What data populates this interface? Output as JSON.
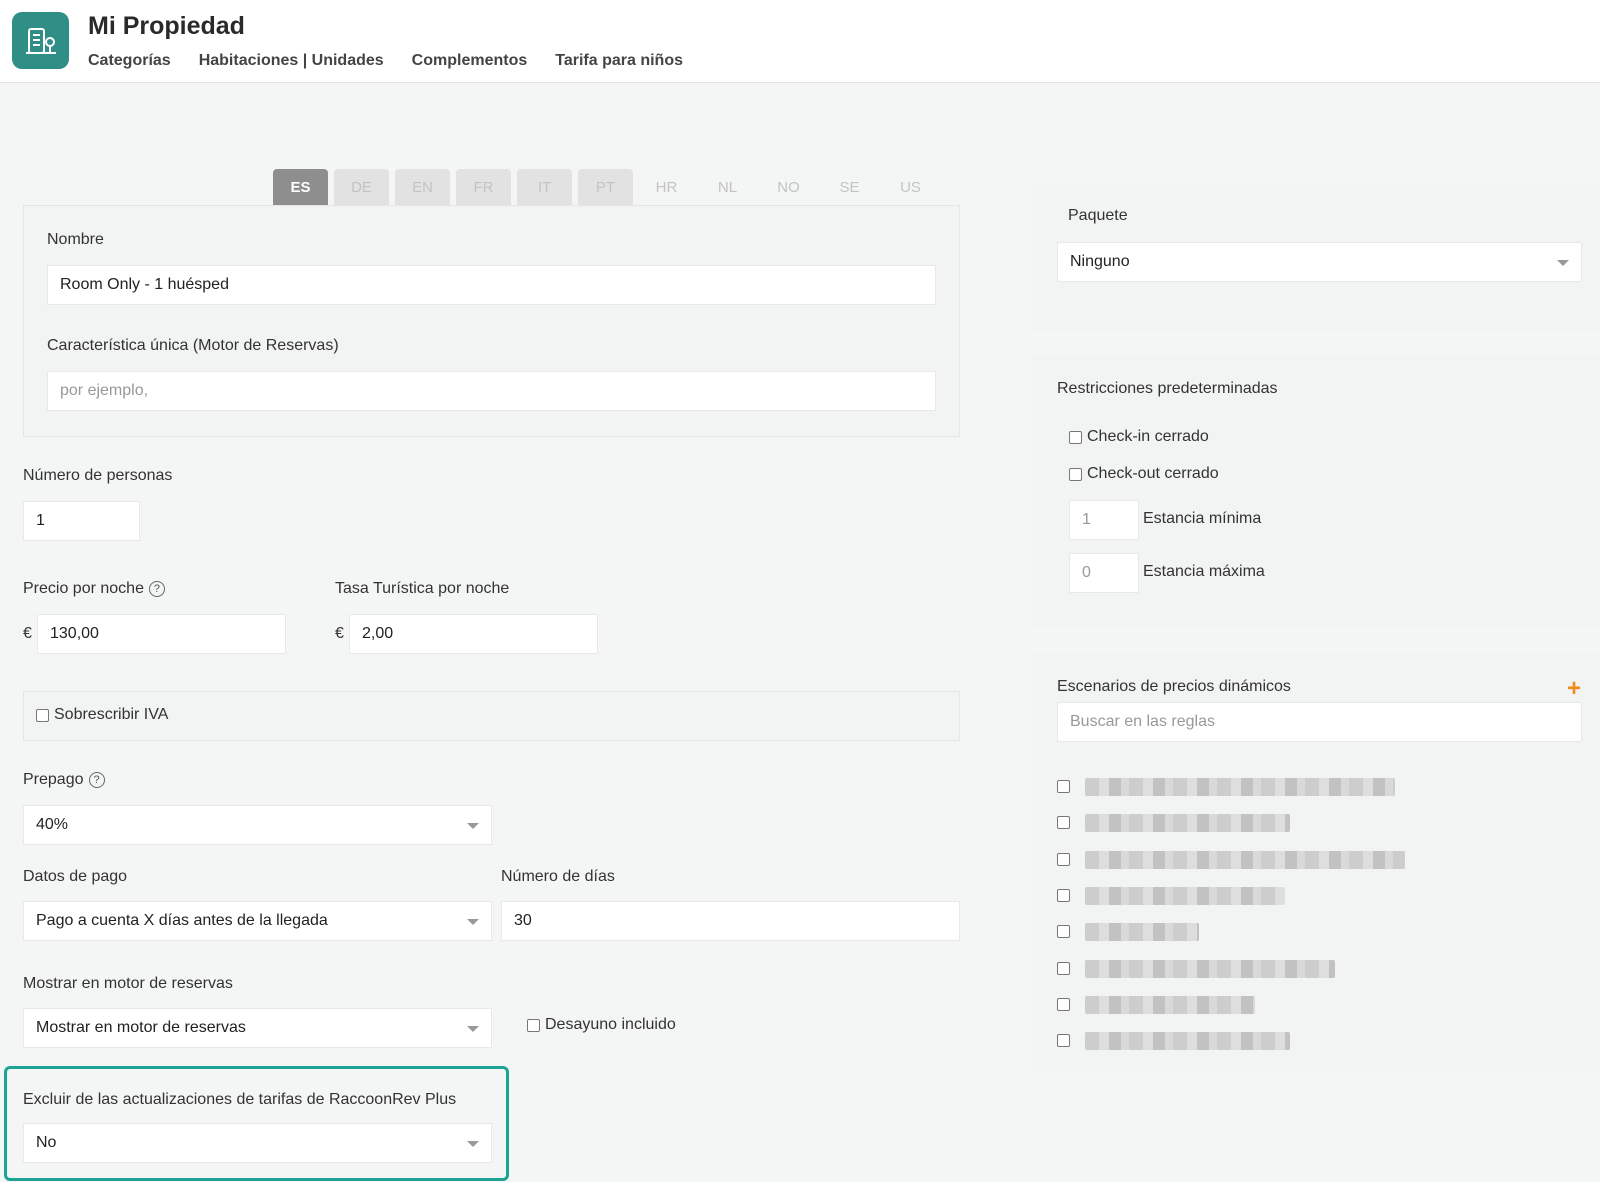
{
  "header": {
    "title": "Mi Propiedad",
    "nav": [
      "Categorías",
      "Habitaciones | Unidades",
      "Complementos",
      "Tarifa para niños"
    ]
  },
  "languages": [
    {
      "code": "ES",
      "state": "active"
    },
    {
      "code": "DE",
      "state": "filled"
    },
    {
      "code": "EN",
      "state": "filled"
    },
    {
      "code": "FR",
      "state": "filled"
    },
    {
      "code": "IT",
      "state": "filled"
    },
    {
      "code": "PT",
      "state": "filled"
    },
    {
      "code": "HR",
      "state": "empty"
    },
    {
      "code": "NL",
      "state": "empty"
    },
    {
      "code": "NO",
      "state": "empty"
    },
    {
      "code": "SE",
      "state": "empty"
    },
    {
      "code": "US",
      "state": "empty"
    }
  ],
  "form": {
    "name_label": "Nombre",
    "name_value": "Room Only - 1 huésped",
    "feature_label": "Característica única (Motor de Reservas)",
    "feature_placeholder": "por ejemplo,",
    "persons_label": "Número de personas",
    "persons_value": "1",
    "price_label": "Precio por noche",
    "price_currency": "€",
    "price_value": "130,00",
    "tax_label": "Tasa Turística por noche",
    "tax_currency": "€",
    "tax_value": "2,00",
    "vat_override_label": "Sobrescribir IVA",
    "prepay_label": "Prepago",
    "prepay_value": "40%",
    "payment_label": "Datos de pago",
    "payment_value": "Pago a cuenta X días antes de la llegada",
    "days_label": "Número de días",
    "days_value": "30",
    "show_label": "Mostrar en motor de reservas",
    "show_value": "Mostrar en motor de reservas",
    "breakfast_label": "Desayuno incluido",
    "exclude_label": "Excluir de las actualizaciones de tarifas de RaccoonRev Plus",
    "exclude_value": "No"
  },
  "package": {
    "label": "Paquete",
    "value": "Ninguno"
  },
  "restrictions": {
    "title": "Restricciones predeterminadas",
    "checkin_closed": "Check-in cerrado",
    "checkout_closed": "Check-out cerrado",
    "min_stay_value": "1",
    "min_stay_label": "Estancia mínima",
    "max_stay_value": "0",
    "max_stay_label": "Estancia máxima"
  },
  "dynamic": {
    "title": "Escenarios de precios dinámicos",
    "search_placeholder": "Buscar en las reglas",
    "rule_count": 8
  },
  "colors": {
    "brand": "#2f8f86",
    "highlight": "#1ea393",
    "add": "#f08a1c"
  }
}
